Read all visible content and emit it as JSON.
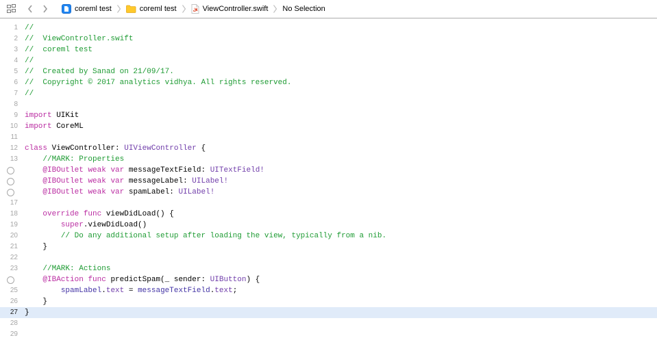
{
  "jump_bar": {
    "related_items_icon": "related-items-grid",
    "back_button": "chevron-left",
    "forward_button": "chevron-right",
    "breadcrumbs": [
      {
        "icon": "app-file",
        "label": "coreml test"
      },
      {
        "icon": "folder",
        "label": "coreml test"
      },
      {
        "icon": "swift-file",
        "label": "ViewController.swift"
      },
      {
        "icon": null,
        "label": "No Selection"
      }
    ]
  },
  "editor": {
    "colors": {
      "plain": "#000000",
      "keyword": "#ba2da2",
      "comment": "#1e9b33",
      "type": "#703daa",
      "property": "#4334a5",
      "line_number": "#a6a6a6",
      "selected_line_number": "#1c1c1c",
      "selected_line_bg": "#e0ebf9",
      "connector_stroke": "#a8a8a8"
    },
    "lines": [
      {
        "n": 1,
        "g": "num",
        "s": [
          [
            "//",
            "comment"
          ]
        ]
      },
      {
        "n": 2,
        "g": "num",
        "s": [
          [
            "//  ViewController.swift",
            "comment"
          ]
        ]
      },
      {
        "n": 3,
        "g": "num",
        "s": [
          [
            "//  coreml test",
            "comment"
          ]
        ]
      },
      {
        "n": 4,
        "g": "num",
        "s": [
          [
            "//",
            "comment"
          ]
        ]
      },
      {
        "n": 5,
        "g": "num",
        "s": [
          [
            "//  Created by Sanad on 21/09/17.",
            "comment"
          ]
        ]
      },
      {
        "n": 6,
        "g": "num",
        "s": [
          [
            "//  Copyright © 2017 analytics vidhya. All rights reserved.",
            "comment"
          ]
        ]
      },
      {
        "n": 7,
        "g": "num",
        "s": [
          [
            "//",
            "comment"
          ]
        ]
      },
      {
        "n": 8,
        "g": "num",
        "s": []
      },
      {
        "n": 9,
        "g": "num",
        "s": [
          [
            "import",
            "keyword"
          ],
          [
            " UIKit",
            "plain"
          ]
        ]
      },
      {
        "n": 10,
        "g": "num",
        "s": [
          [
            "import",
            "keyword"
          ],
          [
            " CoreML",
            "plain"
          ]
        ]
      },
      {
        "n": 11,
        "g": "num",
        "s": []
      },
      {
        "n": 12,
        "g": "num",
        "s": [
          [
            "class",
            "keyword"
          ],
          [
            " ViewController: ",
            "plain"
          ],
          [
            "UIViewController",
            "type"
          ],
          [
            " {",
            "plain"
          ]
        ]
      },
      {
        "n": 13,
        "g": "num",
        "s": [
          [
            "    ",
            "plain"
          ],
          [
            "//MARK: Properties",
            "comment"
          ]
        ]
      },
      {
        "n": 14,
        "g": "circle",
        "s": [
          [
            "    ",
            "plain"
          ],
          [
            "@IBOutlet",
            "keyword"
          ],
          [
            " ",
            "plain"
          ],
          [
            "weak",
            "keyword"
          ],
          [
            " ",
            "plain"
          ],
          [
            "var",
            "keyword"
          ],
          [
            " messageTextField: ",
            "plain"
          ],
          [
            "UITextField!",
            "type"
          ]
        ]
      },
      {
        "n": 15,
        "g": "circle",
        "s": [
          [
            "    ",
            "plain"
          ],
          [
            "@IBOutlet",
            "keyword"
          ],
          [
            " ",
            "plain"
          ],
          [
            "weak",
            "keyword"
          ],
          [
            " ",
            "plain"
          ],
          [
            "var",
            "keyword"
          ],
          [
            " messageLabel: ",
            "plain"
          ],
          [
            "UILabel!",
            "type"
          ]
        ]
      },
      {
        "n": 16,
        "g": "circle",
        "s": [
          [
            "    ",
            "plain"
          ],
          [
            "@IBOutlet",
            "keyword"
          ],
          [
            " ",
            "plain"
          ],
          [
            "weak",
            "keyword"
          ],
          [
            " ",
            "plain"
          ],
          [
            "var",
            "keyword"
          ],
          [
            " spamLabel: ",
            "plain"
          ],
          [
            "UILabel!",
            "type"
          ]
        ]
      },
      {
        "n": 17,
        "g": "num",
        "s": []
      },
      {
        "n": 18,
        "g": "num",
        "s": [
          [
            "    ",
            "plain"
          ],
          [
            "override",
            "keyword"
          ],
          [
            " ",
            "plain"
          ],
          [
            "func",
            "keyword"
          ],
          [
            " viewDidLoad() {",
            "plain"
          ]
        ]
      },
      {
        "n": 19,
        "g": "num",
        "s": [
          [
            "        ",
            "plain"
          ],
          [
            "super",
            "keyword"
          ],
          [
            ".viewDidLoad()",
            "plain"
          ]
        ]
      },
      {
        "n": 20,
        "g": "num",
        "s": [
          [
            "        ",
            "plain"
          ],
          [
            "// Do any additional setup after loading the view, typically from a nib.",
            "comment"
          ]
        ]
      },
      {
        "n": 21,
        "g": "num",
        "s": [
          [
            "    }",
            "plain"
          ]
        ]
      },
      {
        "n": 22,
        "g": "num",
        "s": []
      },
      {
        "n": 23,
        "g": "num",
        "s": [
          [
            "    ",
            "plain"
          ],
          [
            "//MARK: Actions",
            "comment"
          ]
        ]
      },
      {
        "n": 24,
        "g": "circle",
        "s": [
          [
            "    ",
            "plain"
          ],
          [
            "@IBAction",
            "keyword"
          ],
          [
            " ",
            "plain"
          ],
          [
            "func",
            "keyword"
          ],
          [
            " predictSpam(_ sender: ",
            "plain"
          ],
          [
            "UIButton",
            "type"
          ],
          [
            ") {",
            "plain"
          ]
        ]
      },
      {
        "n": 25,
        "g": "num",
        "s": [
          [
            "        ",
            "plain"
          ],
          [
            "spamLabel",
            "property"
          ],
          [
            ".",
            "plain"
          ],
          [
            "text",
            "type"
          ],
          [
            " = ",
            "plain"
          ],
          [
            "messageTextField",
            "property"
          ],
          [
            ".",
            "plain"
          ],
          [
            "text",
            "type"
          ],
          [
            ";",
            "plain"
          ]
        ]
      },
      {
        "n": 26,
        "g": "num",
        "s": [
          [
            "    }",
            "plain"
          ]
        ]
      },
      {
        "n": 27,
        "g": "num",
        "sel": true,
        "s": [
          [
            "}",
            "plain"
          ]
        ]
      },
      {
        "n": 28,
        "g": "num",
        "s": []
      },
      {
        "n": 29,
        "g": "num",
        "s": []
      }
    ]
  }
}
